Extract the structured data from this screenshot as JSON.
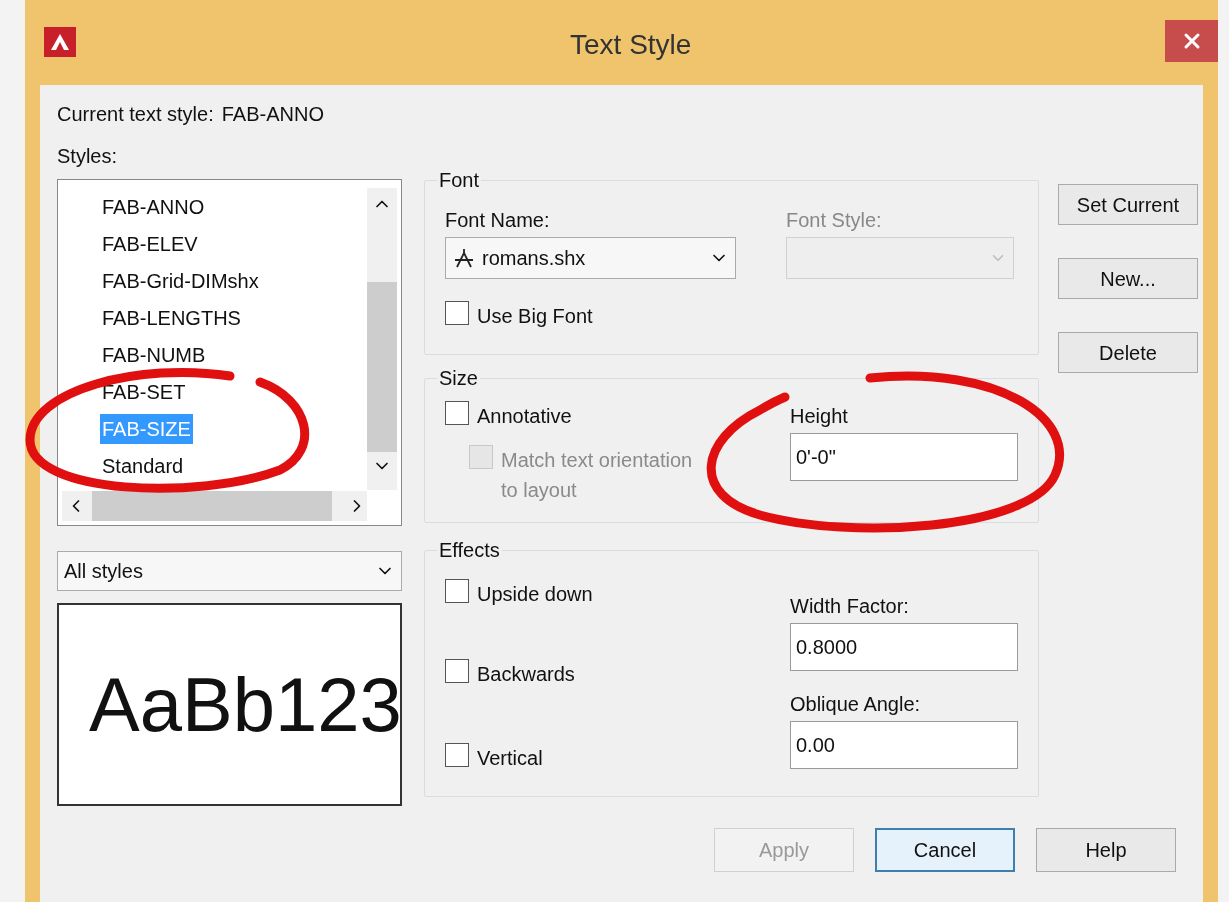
{
  "window": {
    "title": "Text Style"
  },
  "current_style": {
    "label": "Current text style:",
    "value": "FAB-ANNO"
  },
  "styles_label": "Styles:",
  "styles": [
    {
      "name": "FAB-ANNO",
      "selected": false
    },
    {
      "name": "FAB-ELEV",
      "selected": false
    },
    {
      "name": "FAB-Grid-DIMshx",
      "selected": false
    },
    {
      "name": "FAB-LENGTHS",
      "selected": false
    },
    {
      "name": "FAB-NUMB",
      "selected": false
    },
    {
      "name": "FAB-SET",
      "selected": false
    },
    {
      "name": "FAB-SIZE",
      "selected": true
    },
    {
      "name": "Standard",
      "selected": false
    }
  ],
  "filter": {
    "value": "All styles"
  },
  "preview": {
    "text": "AaBb123"
  },
  "font": {
    "title": "Font",
    "font_name_label": "Font Name:",
    "font_name": "romans.shx",
    "font_style_label": "Font Style:",
    "font_style_disabled": true,
    "use_big_font": {
      "label": "Use Big Font",
      "checked": false
    }
  },
  "size": {
    "title": "Size",
    "annotative": {
      "label": "Annotative",
      "checked": false
    },
    "match_orientation": {
      "label": "Match text orientation to layout",
      "checked": false,
      "disabled": true
    },
    "height_label": "Height",
    "height": "0'-0\""
  },
  "effects": {
    "title": "Effects",
    "checkboxes": [
      {
        "label": "Upside down",
        "checked": false
      },
      {
        "label": "Backwards",
        "checked": false
      },
      {
        "label": "Vertical",
        "checked": false
      }
    ],
    "width_factor_label": "Width Factor:",
    "width_factor": "0.8000",
    "oblique_label": "Oblique Angle:",
    "oblique": "0.00"
  },
  "side_buttons": [
    {
      "label": "Set Current"
    },
    {
      "label": "New..."
    },
    {
      "label": "Delete"
    }
  ],
  "bottom_buttons": [
    {
      "label": "Apply",
      "disabled": true,
      "focused": false
    },
    {
      "label": "Cancel",
      "disabled": false,
      "focused": true
    },
    {
      "label": "Help",
      "disabled": false,
      "focused": false
    }
  ]
}
